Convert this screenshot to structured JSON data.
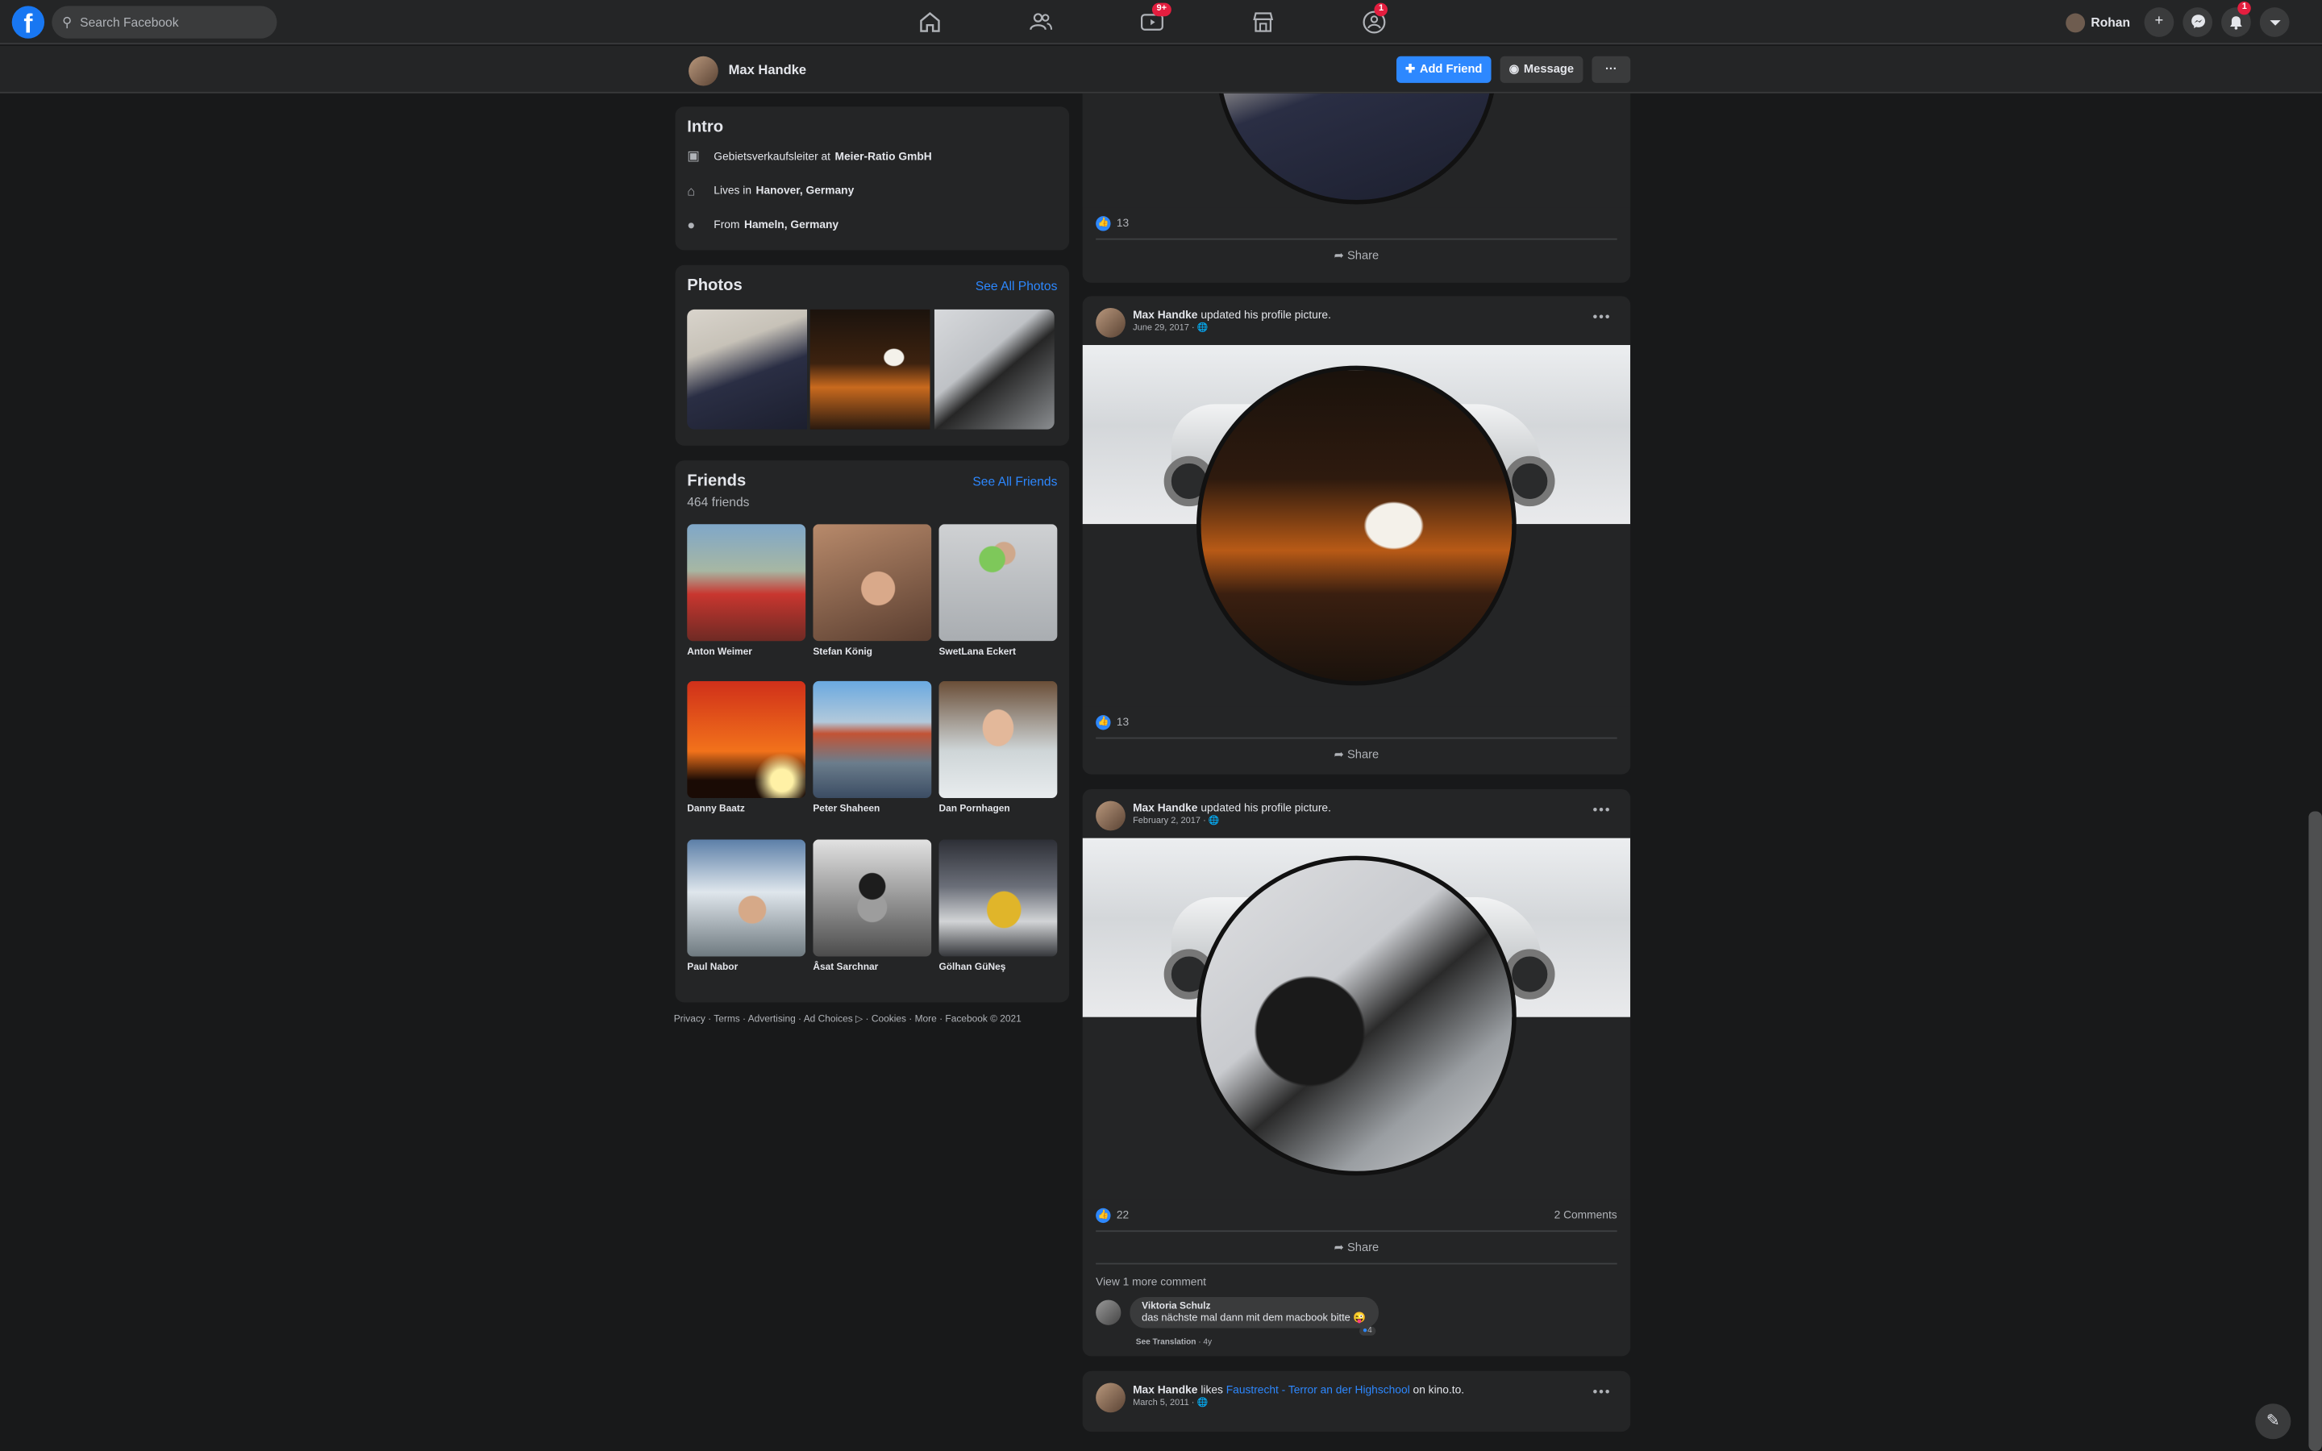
{
  "topbar": {
    "search_placeholder": "Search Facebook",
    "watch_badge": "9+",
    "groups_badge": "1",
    "user_name": "Rohan",
    "notifications_badge": "1"
  },
  "profile_bar": {
    "name": "Max Handke",
    "add_friend_label": "Add Friend",
    "message_label": "Message",
    "more_label": "···"
  },
  "intro": {
    "title": "Intro",
    "work_prefix": "Gebietsverkaufsleiter at",
    "work_place": "Meier-Ratio GmbH",
    "lives_prefix": "Lives in",
    "lives_place": "Hanover, Germany",
    "from_prefix": "From",
    "from_place": "Hameln, Germany"
  },
  "photos": {
    "title": "Photos",
    "see_all": "See All Photos"
  },
  "friends": {
    "title": "Friends",
    "see_all": "See All Friends",
    "count": "464 friends",
    "list": [
      {
        "name": "Anton Weimer"
      },
      {
        "name": "Stefan König"
      },
      {
        "name": "SwetLana Eckert"
      },
      {
        "name": "Danny Baatz"
      },
      {
        "name": "Peter Shaheen"
      },
      {
        "name": "Dan Pornhagen"
      },
      {
        "name": "Paul Nabor"
      },
      {
        "name": "Âsat Sarchnar"
      },
      {
        "name": "Gölhan GüNeş"
      }
    ]
  },
  "footer": {
    "text": "Privacy · Terms · Advertising · Ad Choices ▷ · Cookies · More · Facebook © 2021"
  },
  "posts": [
    {
      "likes": "13",
      "share": "Share"
    },
    {
      "author": "Max Handke",
      "action": "updated his profile picture.",
      "date": "June 29, 2017 · 🌐",
      "likes": "13",
      "share": "Share"
    },
    {
      "author": "Max Handke",
      "action": "updated his profile picture.",
      "date": "February 2, 2017 · 🌐",
      "likes": "22",
      "comments": "2 Comments",
      "share": "Share",
      "view_more": "View 1 more comment",
      "comment_author": "Viktoria Schulz",
      "comment_text": "das nächste mal dann mit dem macbook bitte 😜",
      "comment_reacts": "4",
      "see_translation": "See Translation",
      "comment_age": "· 4y"
    },
    {
      "author": "Max Handke",
      "action_prefix": "likes",
      "page_link": "Faustrecht - Terror an der Highschool",
      "action_suffix": "on kino.to.",
      "date": "March 5, 2011 · 🌐"
    }
  ]
}
